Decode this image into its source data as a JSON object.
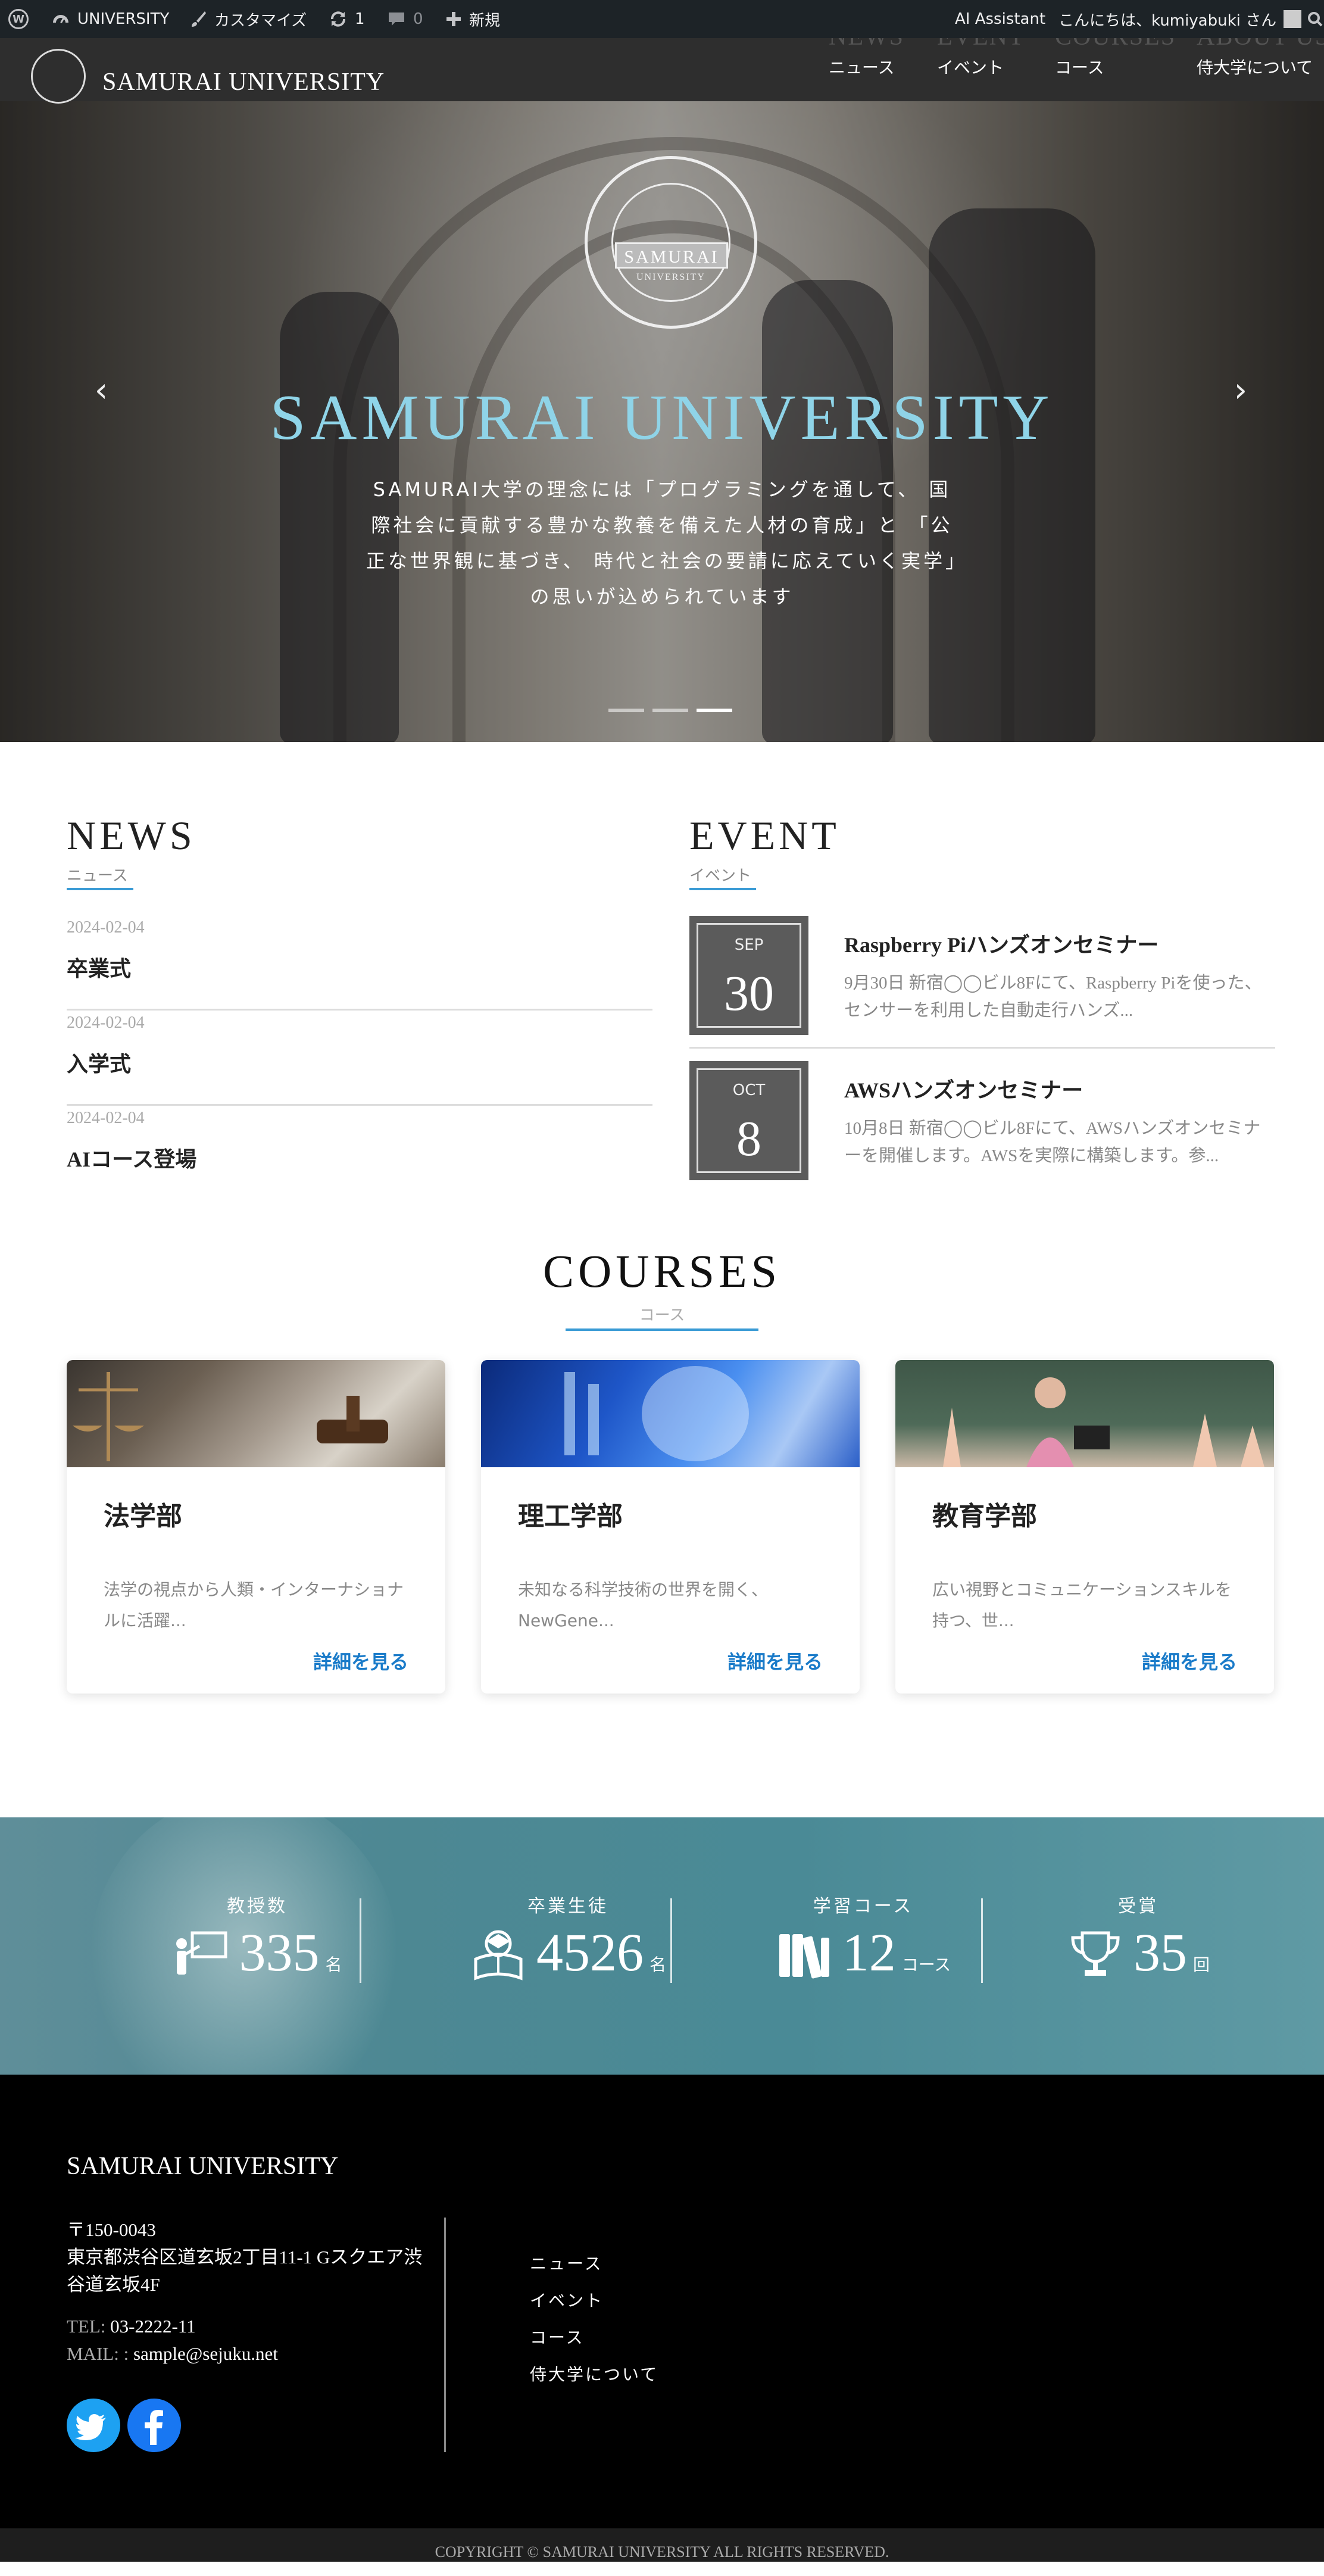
{
  "admin_bar": {
    "site_name": "UNIVERSITY",
    "customize": "カスタマイズ",
    "updates_count": "1",
    "comments_count": "0",
    "new": "新規",
    "ai_assistant": "AI Assistant",
    "greeting": "こんにちは、kumiyabuki さん"
  },
  "header": {
    "site_title": "SAMURAI UNIVERSITY",
    "nav": [
      {
        "en": "NEWS",
        "ja": "ニュース"
      },
      {
        "en": "EVENT",
        "ja": "イベント"
      },
      {
        "en": "COURSES",
        "ja": "コース"
      },
      {
        "en": "ABOUT US",
        "ja": "侍大学について"
      }
    ]
  },
  "hero": {
    "logo_text": "SAMURAI",
    "logo_sub": "UNIVERSITY",
    "title": "SAMURAI UNIVERSITY",
    "text": "SAMURAI大学の理念には「プログラミングを通して、 国際社会に貢献する豊かな教養を備えた人材の育成」と 「公正な世界観に基づき、 時代と社会の要請に応えていく実学」の思いが込められています",
    "prev_arrow": "‹",
    "next_arrow": "›",
    "active_slide": 3,
    "slide_count": 3
  },
  "news": {
    "heading": "NEWS",
    "sub": "ニュース",
    "items": [
      {
        "date": "2024-02-04",
        "title": "卒業式"
      },
      {
        "date": "2024-02-04",
        "title": "入学式"
      },
      {
        "date": "2024-02-04",
        "title": "AIコース登場"
      }
    ]
  },
  "event": {
    "heading": "EVENT",
    "sub": "イベント",
    "items": [
      {
        "month": "SEP",
        "day": "30",
        "title": "Raspberry Piハンズオンセミナー",
        "desc": "9月30日 新宿◯◯ビル8Fにて、Raspberry Piを使った、センサーを利用した自動走行ハンズ..."
      },
      {
        "month": "OCT",
        "day": "8",
        "title": "AWSハンズオンセミナー",
        "desc": "10月8日 新宿◯◯ビル8Fにて、AWSハンズオンセミナーを開催します。AWSを実際に構築します。参..."
      }
    ]
  },
  "courses": {
    "heading": "COURSES",
    "sub": "コース",
    "items": [
      {
        "title": "法学部",
        "desc": "法学の視点から人類・インターナショナルに活躍...",
        "link": "詳細を見る"
      },
      {
        "title": "理工学部",
        "desc": "未知なる科学技術の世界を開く、NewGene...",
        "link": "詳細を見る"
      },
      {
        "title": "教育学部",
        "desc": "広い視野とコミュニケーションスキルを持つ、世...",
        "link": "詳細を見る"
      }
    ]
  },
  "stats": [
    {
      "label": "教授数",
      "value": "335",
      "unit": "名",
      "icon": "teacher-icon"
    },
    {
      "label": "卒業生徒",
      "value": "4526",
      "unit": "名",
      "icon": "graduate-icon"
    },
    {
      "label": "学習コース",
      "value": "12",
      "unit": "コース",
      "icon": "books-icon"
    },
    {
      "label": "受賞",
      "value": "35",
      "unit": "回",
      "icon": "trophy-icon"
    }
  ],
  "footer": {
    "title": "SAMURAI UNIVERSITY",
    "postal": "〒150-0043",
    "address": "東京都渋谷区道玄坂2丁目11-1 Gスクエア渋谷道玄坂4F",
    "tel_label": "TEL:",
    "tel": "03-2222-11",
    "mail_label": "MAIL: :",
    "mail": "sample@sejuku.net",
    "links": [
      "ニュース",
      "イベント",
      "コース",
      "侍大学について"
    ],
    "copyright": "COPYRIGHT © SAMURAI UNIVERSITY ALL RIGHTS RESERVED."
  },
  "colors": {
    "accent": "#3a9bd5",
    "hero_title": "#8fd4e8",
    "link": "#1a7bc9",
    "twitter": "#1da1f2",
    "facebook": "#1877f2",
    "stats_bg": "#4d8893"
  }
}
